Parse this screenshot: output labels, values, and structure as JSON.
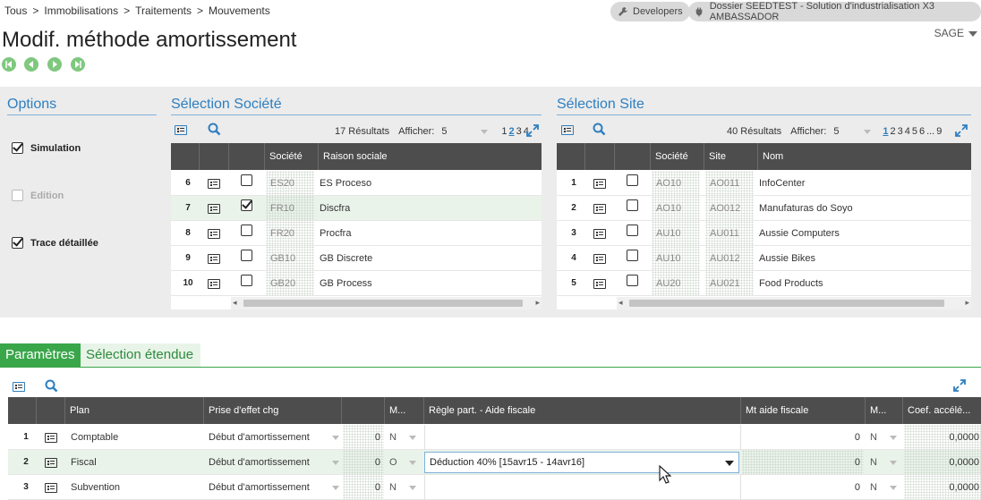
{
  "breadcrumb": [
    "Tous",
    "Immobilisations",
    "Traitements",
    "Mouvements"
  ],
  "breadcrumb_sep": ">",
  "header": {
    "developers_label": "Developers",
    "folder_label": "Dossier SEEDTEST - Solution d'industrialisation X3 AMBASSADOR",
    "page_title": "Modif. méthode amortissement",
    "user_menu": "SAGE"
  },
  "options": {
    "title": "Options",
    "items": [
      {
        "label": "Simulation",
        "checked": true,
        "disabled": false
      },
      {
        "label": "Edition",
        "checked": false,
        "disabled": true
      },
      {
        "label": "Trace détaillée",
        "checked": true,
        "disabled": false
      }
    ]
  },
  "company": {
    "title": "Sélection Société",
    "results": "17 Résultats",
    "show_label": "Afficher:",
    "show_value": "5",
    "pages": [
      "1",
      "2",
      "3",
      "4"
    ],
    "current_page": "2",
    "columns": [
      "Société",
      "Raison sociale"
    ],
    "rows": [
      {
        "n": "6",
        "checked": false,
        "code": "ES20",
        "name": "ES Proceso"
      },
      {
        "n": "7",
        "checked": true,
        "code": "FR10",
        "name": "Discfra"
      },
      {
        "n": "8",
        "checked": false,
        "code": "FR20",
        "name": "Procfra"
      },
      {
        "n": "9",
        "checked": false,
        "code": "GB10",
        "name": "GB Discrete"
      },
      {
        "n": "10",
        "checked": false,
        "code": "GB20",
        "name": "GB Process"
      }
    ]
  },
  "site": {
    "title": "Sélection Site",
    "results": "40 Résultats",
    "show_label": "Afficher:",
    "show_value": "5",
    "pages": [
      "1",
      "2",
      "3",
      "4",
      "5",
      "6",
      "...",
      "9"
    ],
    "current_page": "1",
    "columns": [
      "Société",
      "Site",
      "Nom"
    ],
    "rows": [
      {
        "n": "1",
        "checked": false,
        "company": "AO10",
        "site": "AO011",
        "name": "InfoCenter"
      },
      {
        "n": "2",
        "checked": false,
        "company": "AO10",
        "site": "AO012",
        "name": "Manufaturas do Soyo"
      },
      {
        "n": "3",
        "checked": false,
        "company": "AU10",
        "site": "AU011",
        "name": "Aussie Computers"
      },
      {
        "n": "4",
        "checked": false,
        "company": "AU10",
        "site": "AU012",
        "name": "Aussie Bikes"
      },
      {
        "n": "5",
        "checked": false,
        "company": "AU20",
        "site": "AU021",
        "name": "Food Products"
      }
    ]
  },
  "tabs": [
    "Paramètres",
    "Sélection étendue"
  ],
  "params": {
    "columns": [
      "Plan",
      "Prise d'effet chg",
      "",
      "M...",
      "Règle part. - Aide fiscale",
      "Mt aide fiscale",
      "M...",
      "Coef. accélé..."
    ],
    "rows": [
      {
        "n": "1",
        "plan": "Comptable",
        "effect": "Début d'amortissement",
        "num": "0",
        "m1": "N",
        "rule": "",
        "amount": "0",
        "m2": "N",
        "coef": "0,0000"
      },
      {
        "n": "2",
        "plan": "Fiscal",
        "effect": "Début d'amortissement",
        "num": "0",
        "m1": "O",
        "rule": "Déduction 40% [15avr15 - 14avr16]",
        "amount": "0",
        "m2": "N",
        "coef": "0,0000"
      },
      {
        "n": "3",
        "plan": "Subvention",
        "effect": "Début d'amortissement",
        "num": "0",
        "m1": "N",
        "rule": "",
        "amount": "0",
        "m2": "N",
        "coef": "0,0000"
      }
    ]
  },
  "colors": {
    "accent_blue": "#2e7fc0",
    "accent_green": "#3aa64a",
    "header_dark": "#4d4d4d",
    "panel_grey": "#ececec"
  }
}
